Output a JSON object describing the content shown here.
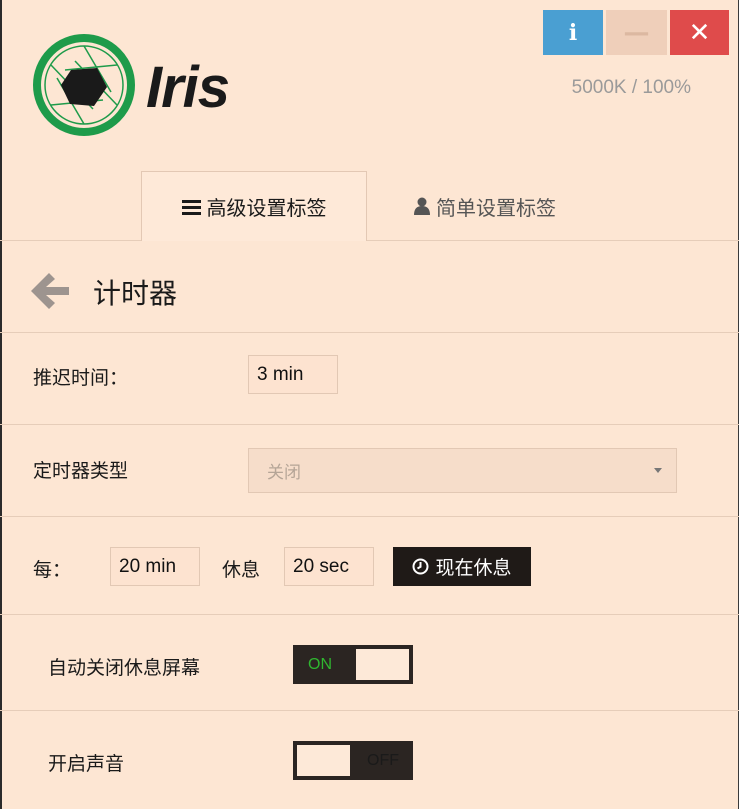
{
  "window": {
    "info_label": "i",
    "minimize_label": "—",
    "close_label": "✕",
    "status": "5000K / 100%"
  },
  "logo": {
    "text": "Iris",
    "ring_color": "#1e9b4a"
  },
  "tabs": [
    {
      "label": "高级设置标签",
      "icon": "menu-icon",
      "active": true
    },
    {
      "label": "简单设置标签",
      "icon": "user-icon",
      "active": false
    }
  ],
  "page": {
    "title": "计时器",
    "back_icon": "arrow-left-icon"
  },
  "delay": {
    "label": "推迟时间：",
    "value": "3 min"
  },
  "timer_type": {
    "label": "定时器类型",
    "value": "关闭"
  },
  "break": {
    "every_label": "每：",
    "every_value": "20 min",
    "rest_label": "休息",
    "rest_value": "20 sec",
    "break_now_label": "现在休息",
    "break_now_icon": "clock-icon"
  },
  "auto_close": {
    "label": "自动关闭休息屏幕",
    "state": "ON",
    "on": true,
    "on_color": "#2fb62f"
  },
  "sound": {
    "label": "开启声音",
    "state": "OFF",
    "on": false
  },
  "colors": {
    "background": "#fde6d3",
    "info": "#4a9fd2",
    "close": "#df4b4b",
    "dark": "#1f1a17"
  }
}
